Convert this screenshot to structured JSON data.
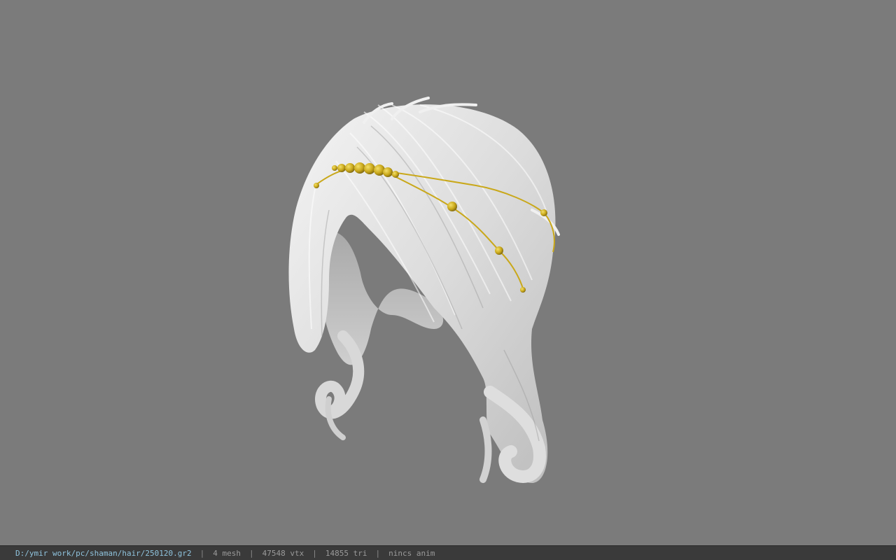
{
  "viewer": {
    "background_color": "#7b7b7b",
    "model_color": "#e6e6e6",
    "ornament_color": "#c9a81a",
    "model_subject": "hair-mesh"
  },
  "statusbar": {
    "file_path": "D:/ymir work/pc/shaman/hair/250120.gr2",
    "separator": "|",
    "mesh_count": "4 mesh",
    "vertex_count": "47548 vtx",
    "triangle_count": "14855 tri",
    "anim_status": "nincs anim"
  }
}
